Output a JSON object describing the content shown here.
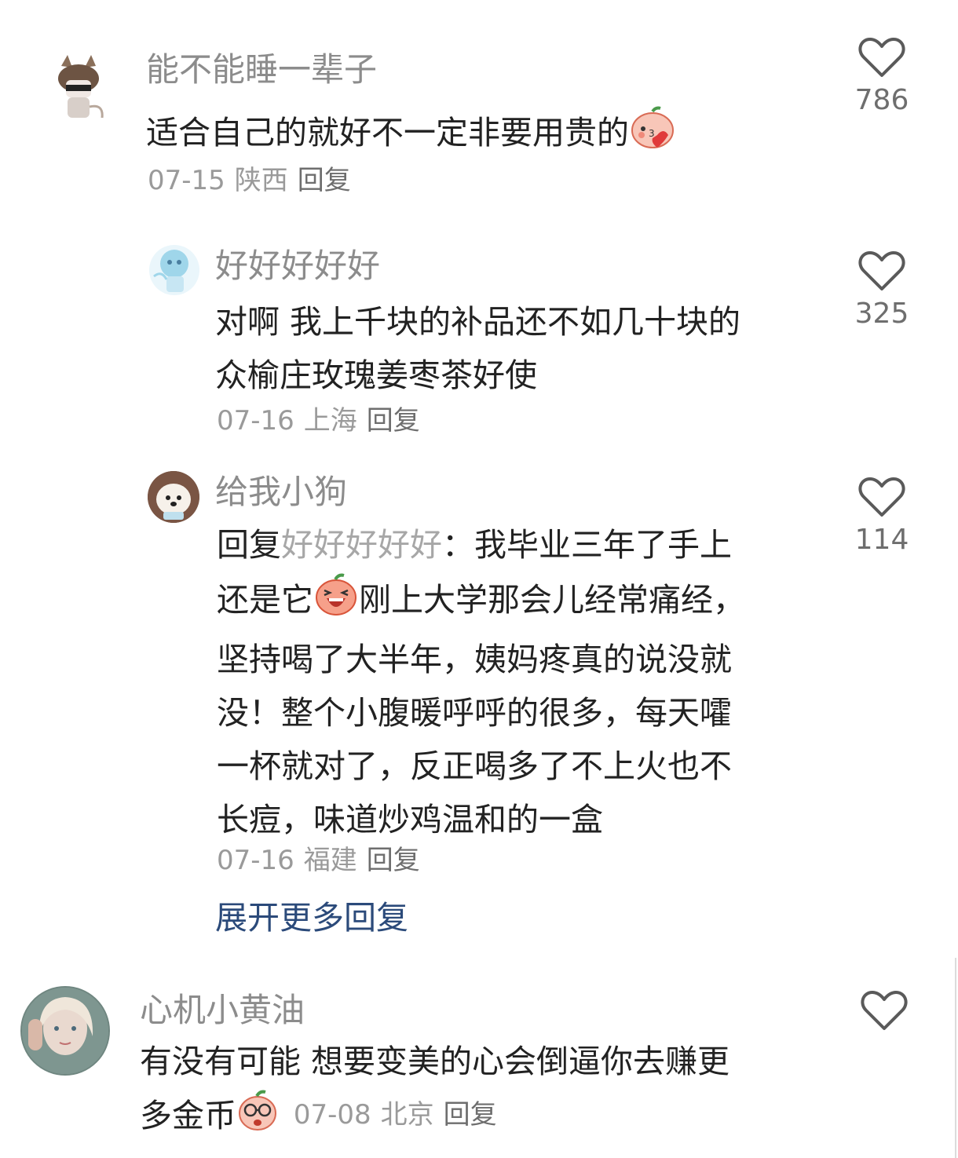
{
  "comments": [
    {
      "username": "能不能睡一辈子",
      "text": "适合自己的就好不一定非要用贵的",
      "emoji": "blush-kiss-emoji",
      "date": "07-15",
      "location": "陕西",
      "reply_label": "回复",
      "likes": "786"
    },
    {
      "username": "好好好好好",
      "text_line1": "对啊 我上千块的补品还不如几十块的",
      "text_line2": "众榆庄玫瑰姜枣茶好使",
      "date": "07-16",
      "location": "上海",
      "reply_label": "回复",
      "likes": "325"
    },
    {
      "username": "给我小狗",
      "reply_prefix": "回复",
      "reply_to": "好好好好好",
      "colon": "：",
      "line1": "我毕业三年了手上",
      "line2a": "还是它",
      "emoji": "laughing-emoji",
      "line2b": "刚上大学那会儿经常痛经，",
      "line3": "坚持喝了大半年，姨妈疼真的说没就",
      "line4": "没！整个小腹暖呼呼的很多，每天嚯",
      "line5": "一杯就对了，反正喝多了不上火也不",
      "line6": "长痘，味道炒鸡温和的一盒",
      "date": "07-16",
      "location": "福建",
      "reply_label": "回复",
      "likes": "114"
    },
    {
      "username": "心机小黄油",
      "text_line1": "有没有可能 想要变美的心会倒逼你去赚更",
      "text_line2": "多金币",
      "emoji": "glasses-emoji",
      "date": "07-08",
      "location": "北京",
      "reply_label": "回复",
      "likes": ""
    }
  ],
  "expand_more_label": "展开更多回复",
  "colors": {
    "accent": "#2b4a7a",
    "username": "#8c8c8c",
    "meta": "#9a9a9a"
  }
}
